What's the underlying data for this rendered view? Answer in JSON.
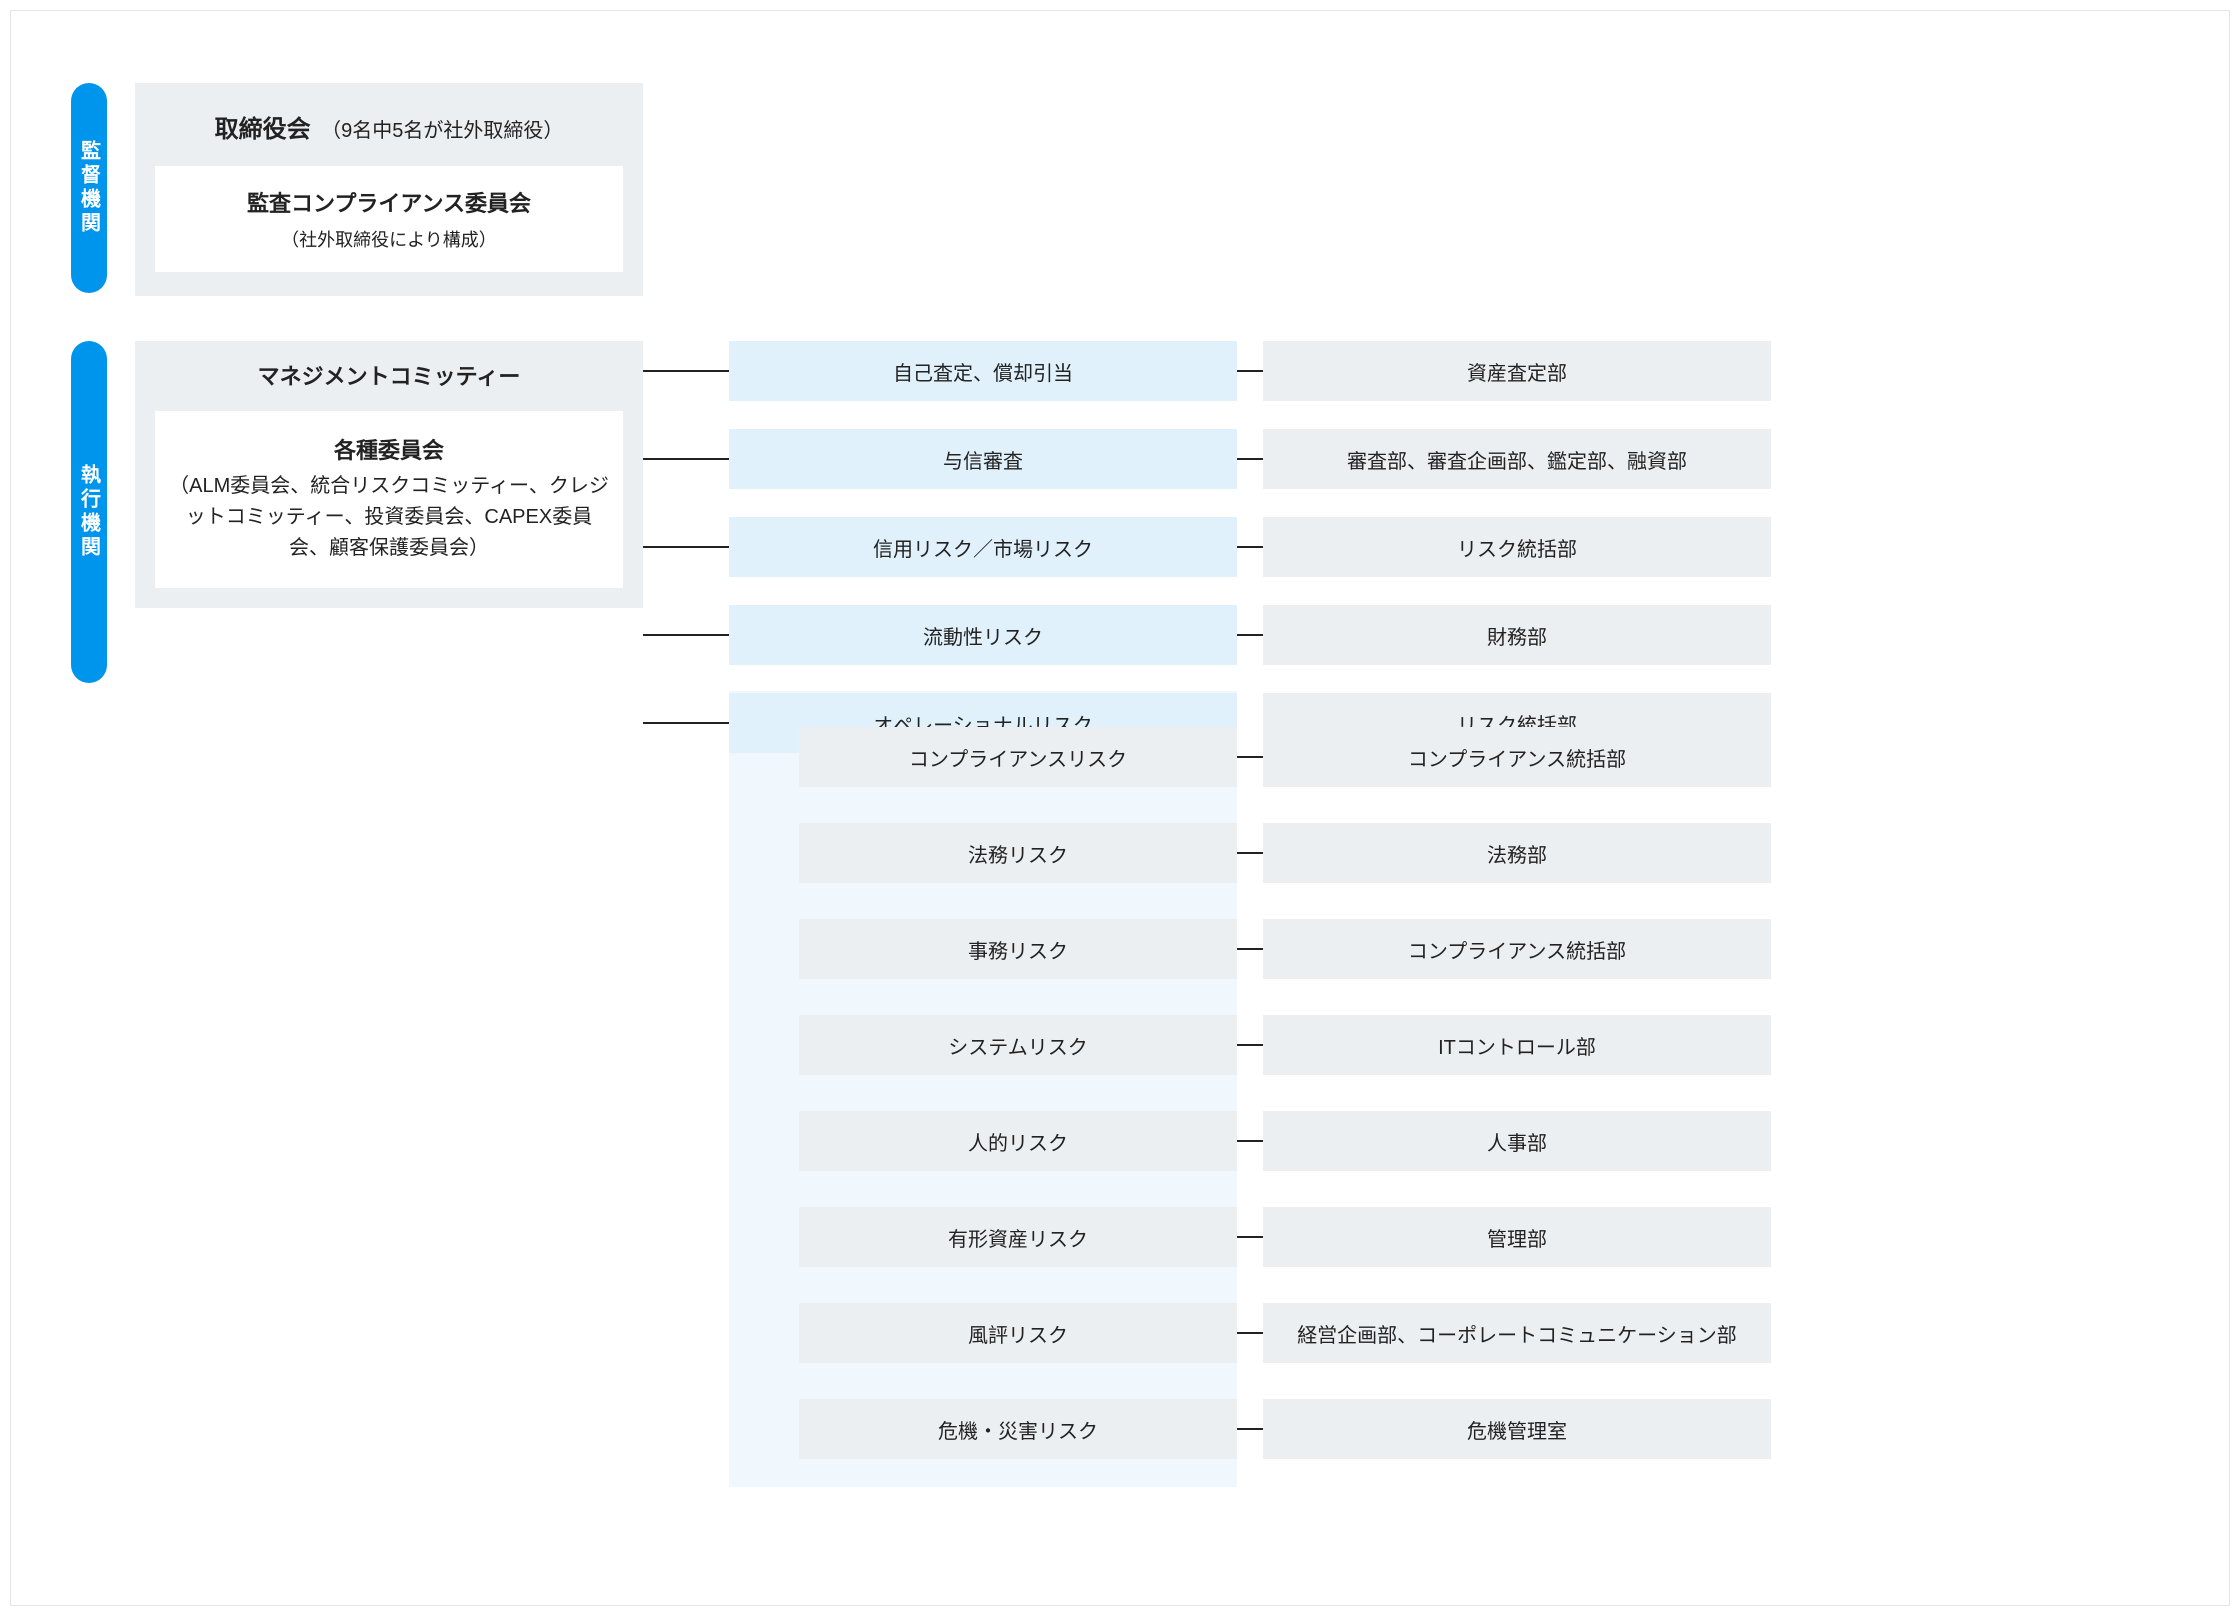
{
  "sections": {
    "supervisory": {
      "label": "監督機関",
      "board_title": "取締役会",
      "board_note": "（9名中5名が社外取締役）",
      "audit_title": "監査コンプライアンス委員会",
      "audit_note": "（社外取締役により構成）"
    },
    "executive": {
      "label": "執行機関",
      "mgmt_title": "マネジメントコミッティー",
      "committees_title": "各種委員会",
      "committees_note": "（ALM委員会、統合リスクコミッティー、クレジットコミッティー、投資委員会、CAPEX委員会、顧客保護委員会）"
    }
  },
  "top_rows": [
    {
      "risk": "自己査定、償却引当",
      "dept": "資産査定部"
    },
    {
      "risk": "与信審査",
      "dept": "審査部、審査企画部、鑑定部、融資部"
    },
    {
      "risk": "信用リスク／市場リスク",
      "dept": "リスク統括部"
    },
    {
      "risk": "流動性リスク",
      "dept": "財務部"
    },
    {
      "risk": "オペレーショナルリスク",
      "dept": "リスク統括部"
    }
  ],
  "sub_rows": [
    {
      "risk": "コンプライアンスリスク",
      "dept": "コンプライアンス統括部"
    },
    {
      "risk": "法務リスク",
      "dept": "法務部"
    },
    {
      "risk": "事務リスク",
      "dept": "コンプライアンス統括部"
    },
    {
      "risk": "システムリスク",
      "dept": "ITコントロール部"
    },
    {
      "risk": "人的リスク",
      "dept": "人事部"
    },
    {
      "risk": "有形資産リスク",
      "dept": "管理部"
    },
    {
      "risk": "風評リスク",
      "dept": "経営企画部、コーポレートコミュニケーション部"
    },
    {
      "risk": "危機・災害リスク",
      "dept": "危機管理室"
    }
  ]
}
